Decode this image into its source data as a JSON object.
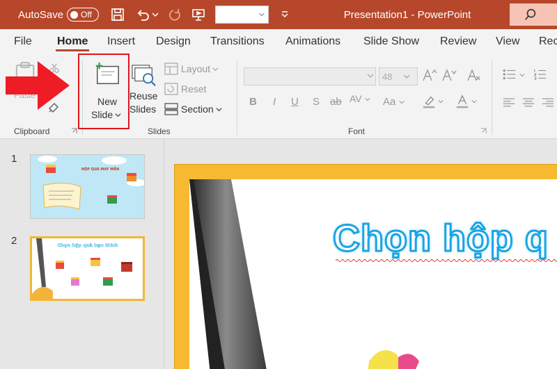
{
  "titlebar": {
    "autosave_label": "AutoSave",
    "autosave_state": "Off",
    "document_title": "Presentation1  -  PowerPoint",
    "accent_color": "#b7472a"
  },
  "tabs": [
    "File",
    "Home",
    "Insert",
    "Design",
    "Transitions",
    "Animations",
    "Slide Show",
    "Review",
    "View",
    "Rec"
  ],
  "ribbon": {
    "clipboard": {
      "group_label": "Clipboard",
      "paste_label": "Paste"
    },
    "slides": {
      "group_label": "Slides",
      "new_slide_line1": "New",
      "new_slide_line2": "Slide",
      "reuse_line1": "Reuse",
      "reuse_line2": "Slides",
      "layout_label": "Layout",
      "reset_label": "Reset",
      "section_label": "Section"
    },
    "font": {
      "group_label": "Font",
      "font_size": "48",
      "bold": "B",
      "italic": "I",
      "underline": "U",
      "shadow": "S",
      "strike": "ab",
      "spacing": "AV",
      "case": "Aa"
    }
  },
  "thumbnails": [
    {
      "number": "1",
      "title": "HỘP QUÀ MAY MẮN"
    },
    {
      "number": "2",
      "title": "Chọn hộp quà bạn thích"
    }
  ],
  "slide": {
    "title": "Chọn hộp q"
  }
}
